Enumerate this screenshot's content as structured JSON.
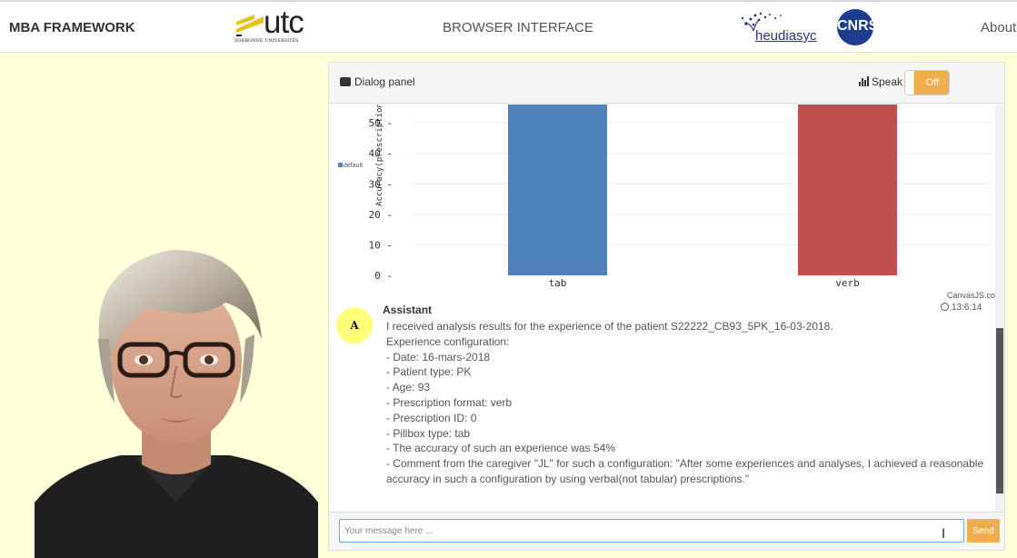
{
  "header": {
    "brand": "MBA FRAMEWORK",
    "title": "BROWSER INTERFACE",
    "about": "About",
    "utc_logo": {
      "text": "utc",
      "subtext": "SORBONNE UNIVERSITÉS"
    },
    "heudiasyc_logo": {
      "text": "heudiasyc"
    },
    "cnrs_logo": {
      "text": "CNRS"
    }
  },
  "dialog": {
    "title": "Dialog panel",
    "speak_label": "Speak",
    "toggle_state": "Off",
    "input_placeholder": "Your message here ...",
    "send_label": "Send"
  },
  "chart_data": {
    "type": "bar",
    "categories": [
      "tab",
      "verb"
    ],
    "ylabel": "Accuracy(prescription",
    "yticks": [
      0,
      10,
      20,
      30,
      40,
      50
    ],
    "ylim": [
      0,
      56
    ],
    "series": [
      {
        "name": "default",
        "values": [
          56,
          56
        ],
        "colors": [
          "#4f81bc",
          "#c0504e"
        ]
      }
    ],
    "legend_position": "left",
    "credit": "CanvasJS.com"
  },
  "message": {
    "avatar_letter": "A",
    "sender": "Assistant",
    "time": "13:6:14",
    "lines": [
      "I received analysis results for the experience of the patient S22222_CB93_5PK_16-03-2018.",
      "Experience configuration:",
      "- Date: 16-mars-2018",
      "- Patient type: PK",
      "- Age: 93",
      "- Prescription format: verb",
      "- Prescription ID: 0",
      "- Pillbox type: tab",
      "- The accuracy of such an experience was 54%",
      "- Comment from the caregiver \"JL\" for such a configuration: \"After some experiences and analyses, I achieved a reasonable accuracy in such a configuration by using verbal(not tabular) prescriptions.\""
    ]
  },
  "colors": {
    "page_background": "#ffffd9",
    "accent_orange": "#f0ad4e",
    "bar_tab": "#4f81bc",
    "bar_verb": "#c0504e"
  }
}
